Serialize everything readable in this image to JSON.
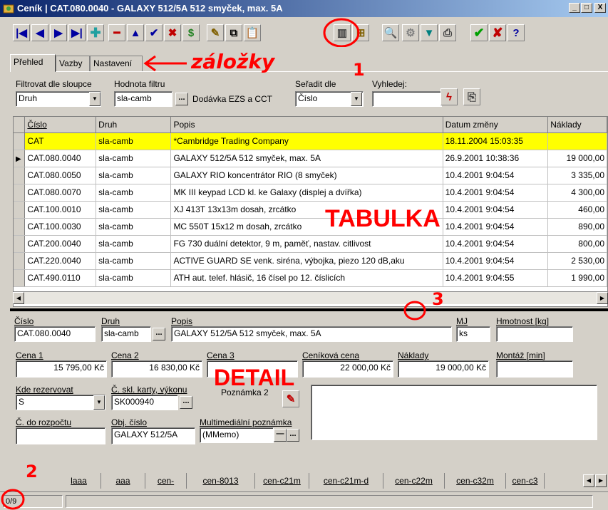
{
  "window": {
    "title": "Ceník | CAT.080.0040 - GALAXY 512/5A 512 smyček, max. 5A",
    "controls": [
      "_",
      "□",
      "X"
    ]
  },
  "toolbar": {
    "buttons": [
      "first-record-icon",
      "prev-record-icon",
      "next-record-icon",
      "last-record-icon",
      "add-icon",
      "delete-icon",
      "up-icon",
      "confirm-icon",
      "cancel-icon",
      "refresh-icon",
      "pin-icon",
      "copy-icon",
      "paste-icon",
      "book-icon",
      "tree-icon",
      "search-icon",
      "settings-icon",
      "filter-icon",
      "print-icon",
      "ok-icon",
      "close-icon",
      "help-icon"
    ]
  },
  "tabs": [
    "Přehled",
    "Vazby",
    "Nastavení"
  ],
  "filter": {
    "column_label": "Filtrovat dle sloupce",
    "column_value": "Druh",
    "value_label": "Hodnota filtru",
    "value_value": "sla-camb",
    "value_desc": "Dodávka EZS a CCT",
    "sort_label": "Seřadit dle",
    "sort_value": "Číslo",
    "search_label": "Vyhledej:",
    "search_value": ""
  },
  "grid": {
    "columns": [
      "Číslo",
      "Druh",
      "Popis",
      "Datum změny",
      "Náklady"
    ],
    "rows": [
      {
        "cislo": "CAT",
        "druh": "sla-camb",
        "popis": "*Cambridge Trading Company",
        "datum": "18.11.2004 15:03:35",
        "naklady": "",
        "highlight": true,
        "current": false
      },
      {
        "cislo": "CAT.080.0040",
        "druh": "sla-camb",
        "popis": "GALAXY 512/5A 512 smyček, max. 5A",
        "datum": "26.9.2001 10:38:36",
        "naklady": "19 000,00",
        "highlight": false,
        "current": true
      },
      {
        "cislo": "CAT.080.0050",
        "druh": "sla-camb",
        "popis": "GALAXY RIO koncentrátor RIO (8 smyček)",
        "datum": "10.4.2001 9:04:54",
        "naklady": "3 335,00",
        "highlight": false,
        "current": false
      },
      {
        "cislo": "CAT.080.0070",
        "druh": "sla-camb",
        "popis": "MK III keypad LCD kl. ke Galaxy (displej a dvířka)",
        "datum": "10.4.2001 9:04:54",
        "naklady": "4 300,00",
        "highlight": false,
        "current": false
      },
      {
        "cislo": "CAT.100.0010",
        "druh": "sla-camb",
        "popis": "XJ 413T 13x13m dosah, zrcátko",
        "datum": "10.4.2001 9:04:54",
        "naklady": "460,00",
        "highlight": false,
        "current": false
      },
      {
        "cislo": "CAT.100.0030",
        "druh": "sla-camb",
        "popis": "MC 550T 15x12 m dosah, zrcátko",
        "datum": "10.4.2001 9:04:54",
        "naklady": "890,00",
        "highlight": false,
        "current": false
      },
      {
        "cislo": "CAT.200.0040",
        "druh": "sla-camb",
        "popis": "FG 730 duální detektor, 9 m, paměť, nastav. citlivost",
        "datum": "10.4.2001 9:04:54",
        "naklady": "800,00",
        "highlight": false,
        "current": false
      },
      {
        "cislo": "CAT.220.0040",
        "druh": "sla-camb",
        "popis": "ACTIVE GUARD SE venk. siréna, výbojka, piezo 120 dB,aku",
        "datum": "10.4.2001 9:04:54",
        "naklady": "2 530,00",
        "highlight": false,
        "current": false
      },
      {
        "cislo": "CAT.490.0110",
        "druh": "sla-camb",
        "popis": "ATH aut. telef. hlásič, 16 čísel po 12. číslicích",
        "datum": "10.4.2001 9:04:55",
        "naklady": "1 990,00",
        "highlight": false,
        "current": false
      }
    ]
  },
  "detail": {
    "cislo_label": "Číslo",
    "cislo": "CAT.080.0040",
    "druh_label": "Druh",
    "druh": "sla-camb",
    "popis_label": "Popis",
    "popis": "GALAXY 512/5A 512 smyček, max. 5A",
    "mj_label": "MJ",
    "mj": "ks",
    "hmotnost_label": "Hmotnost [kg]",
    "hmotnost": "",
    "cena1_label": "Cena 1",
    "cena1": "15 795,00 Kč",
    "cena2_label": "Cena 2",
    "cena2": "16 830,00 Kč",
    "cena3_label": "Cena 3",
    "cena3": "",
    "cenikova_label": "Ceníková cena",
    "cenikova": "22 000,00 Kč",
    "naklady_label": "Náklady",
    "naklady": "19 000,00 Kč",
    "montaz_label": "Montáž [min]",
    "montaz": "",
    "kde_label": "Kde rezervovat",
    "kde": "S",
    "skl_label": "Č. skl. karty, výkonu",
    "skl": "SK000940",
    "poznamka_label": "Poznámka 2",
    "poznamka": "",
    "rozpocet_label": "Č. do rozpočtu",
    "rozpocet": "",
    "obj_label": "Obj. číslo",
    "obj": "GALAXY 512/5A",
    "multi_label": "Multimediální poznámka",
    "multi": "(MMemo)"
  },
  "annotations": {
    "tabs_note": "záložky",
    "table_note": "TABULKA",
    "detail_note": "DETAIL",
    "n1": "1",
    "n2": "2",
    "n3": "3"
  },
  "bottom_tabs": [
    "laaa",
    "aaa",
    "cen-",
    "cen-8013",
    "cen-c21m",
    "cen-c21m-d",
    "cen-c22m",
    "cen-c32m",
    "cen-c3"
  ],
  "status": {
    "record": "0/9"
  }
}
